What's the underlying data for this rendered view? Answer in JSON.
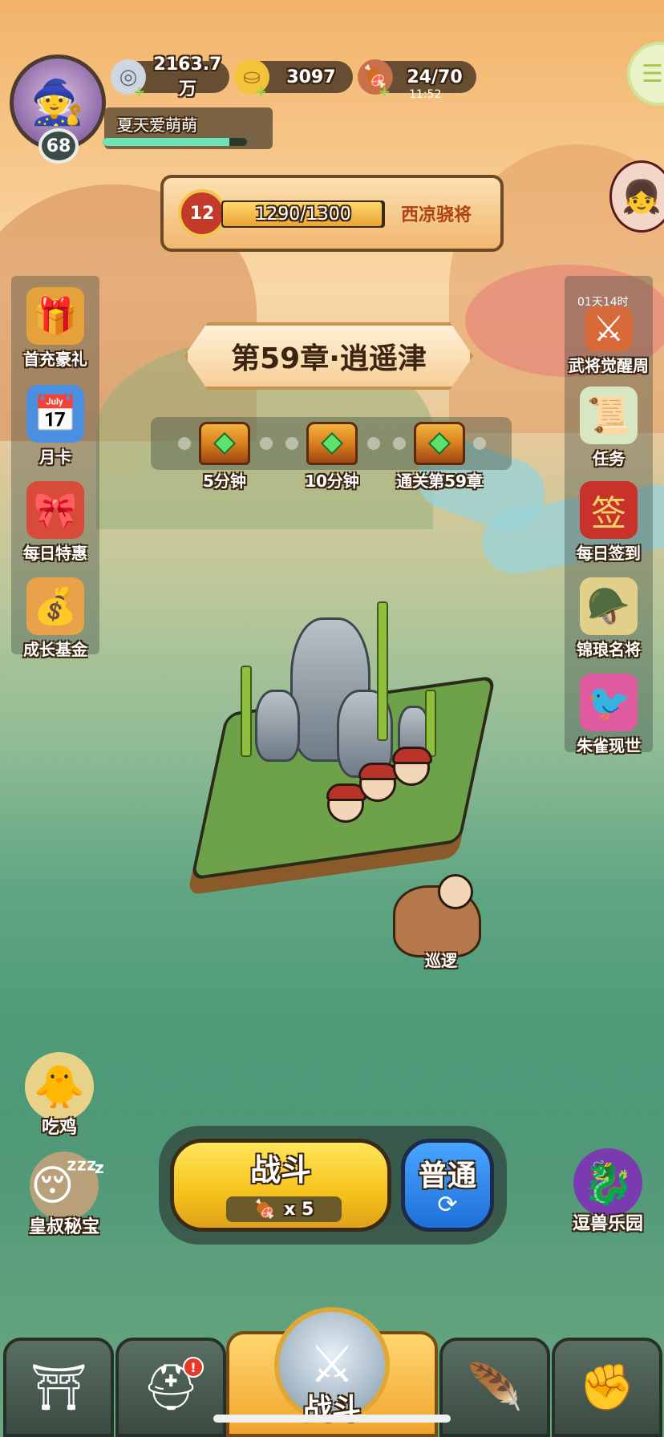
{
  "player": {
    "name": "夏天爱萌萌",
    "level": "68",
    "xp_fraction": 0.88
  },
  "resources": [
    {
      "name": "coin",
      "icon": "coin-icon",
      "value": "2163.7万"
    },
    {
      "name": "gold-ingot",
      "icon": "gold-ingot-icon",
      "value": "3097"
    },
    {
      "name": "stamina",
      "icon": "meat-icon",
      "value": "24/70",
      "sub": "11:52"
    }
  ],
  "progress_banner": {
    "rank": "12",
    "value": "1290/1300",
    "fraction": 0.9923,
    "title": "西凉骁将"
  },
  "left_menu": [
    {
      "label": "首充豪礼",
      "icon": "treasure-chest-icon"
    },
    {
      "label": "月卡",
      "icon": "calendar-card-icon"
    },
    {
      "label": "每日特惠",
      "icon": "gift-bag-icon"
    },
    {
      "label": "成长基金",
      "icon": "money-bag-icon"
    }
  ],
  "right_menu": [
    {
      "label": "武将觉醒周",
      "icon": "hero-awaken-icon",
      "timer": "01天14时"
    },
    {
      "label": "任务",
      "icon": "scroll-icon"
    },
    {
      "label": "每日签到",
      "icon": "sign-in-icon"
    },
    {
      "label": "锦琅名将",
      "icon": "general-icon"
    },
    {
      "label": "朱雀现世",
      "icon": "phoenix-icon"
    }
  ],
  "chapter": {
    "title": "第59章·逍遥津"
  },
  "chests": [
    {
      "label": "5分钟"
    },
    {
      "label": "10分钟"
    },
    {
      "label": "通关第59章"
    }
  ],
  "patrol": {
    "label": "巡逻"
  },
  "characters": [
    {
      "label": "吃鸡",
      "icon": "chicken-hero-icon"
    },
    {
      "label": "皇叔秘宝",
      "icon": "sleeping-hero-icon",
      "extra": "z"
    },
    {
      "label": "逗兽乐园",
      "icon": "beast-park-icon"
    }
  ],
  "battle": {
    "fight_label": "战斗",
    "cost": "x 5",
    "mode_label": "普通"
  },
  "nav": {
    "center_label": "战斗",
    "badge": "!"
  },
  "colors": {
    "accent_yellow": "#f5c21c",
    "accent_blue": "#1e6fd9",
    "banner_text": "#b14214"
  }
}
